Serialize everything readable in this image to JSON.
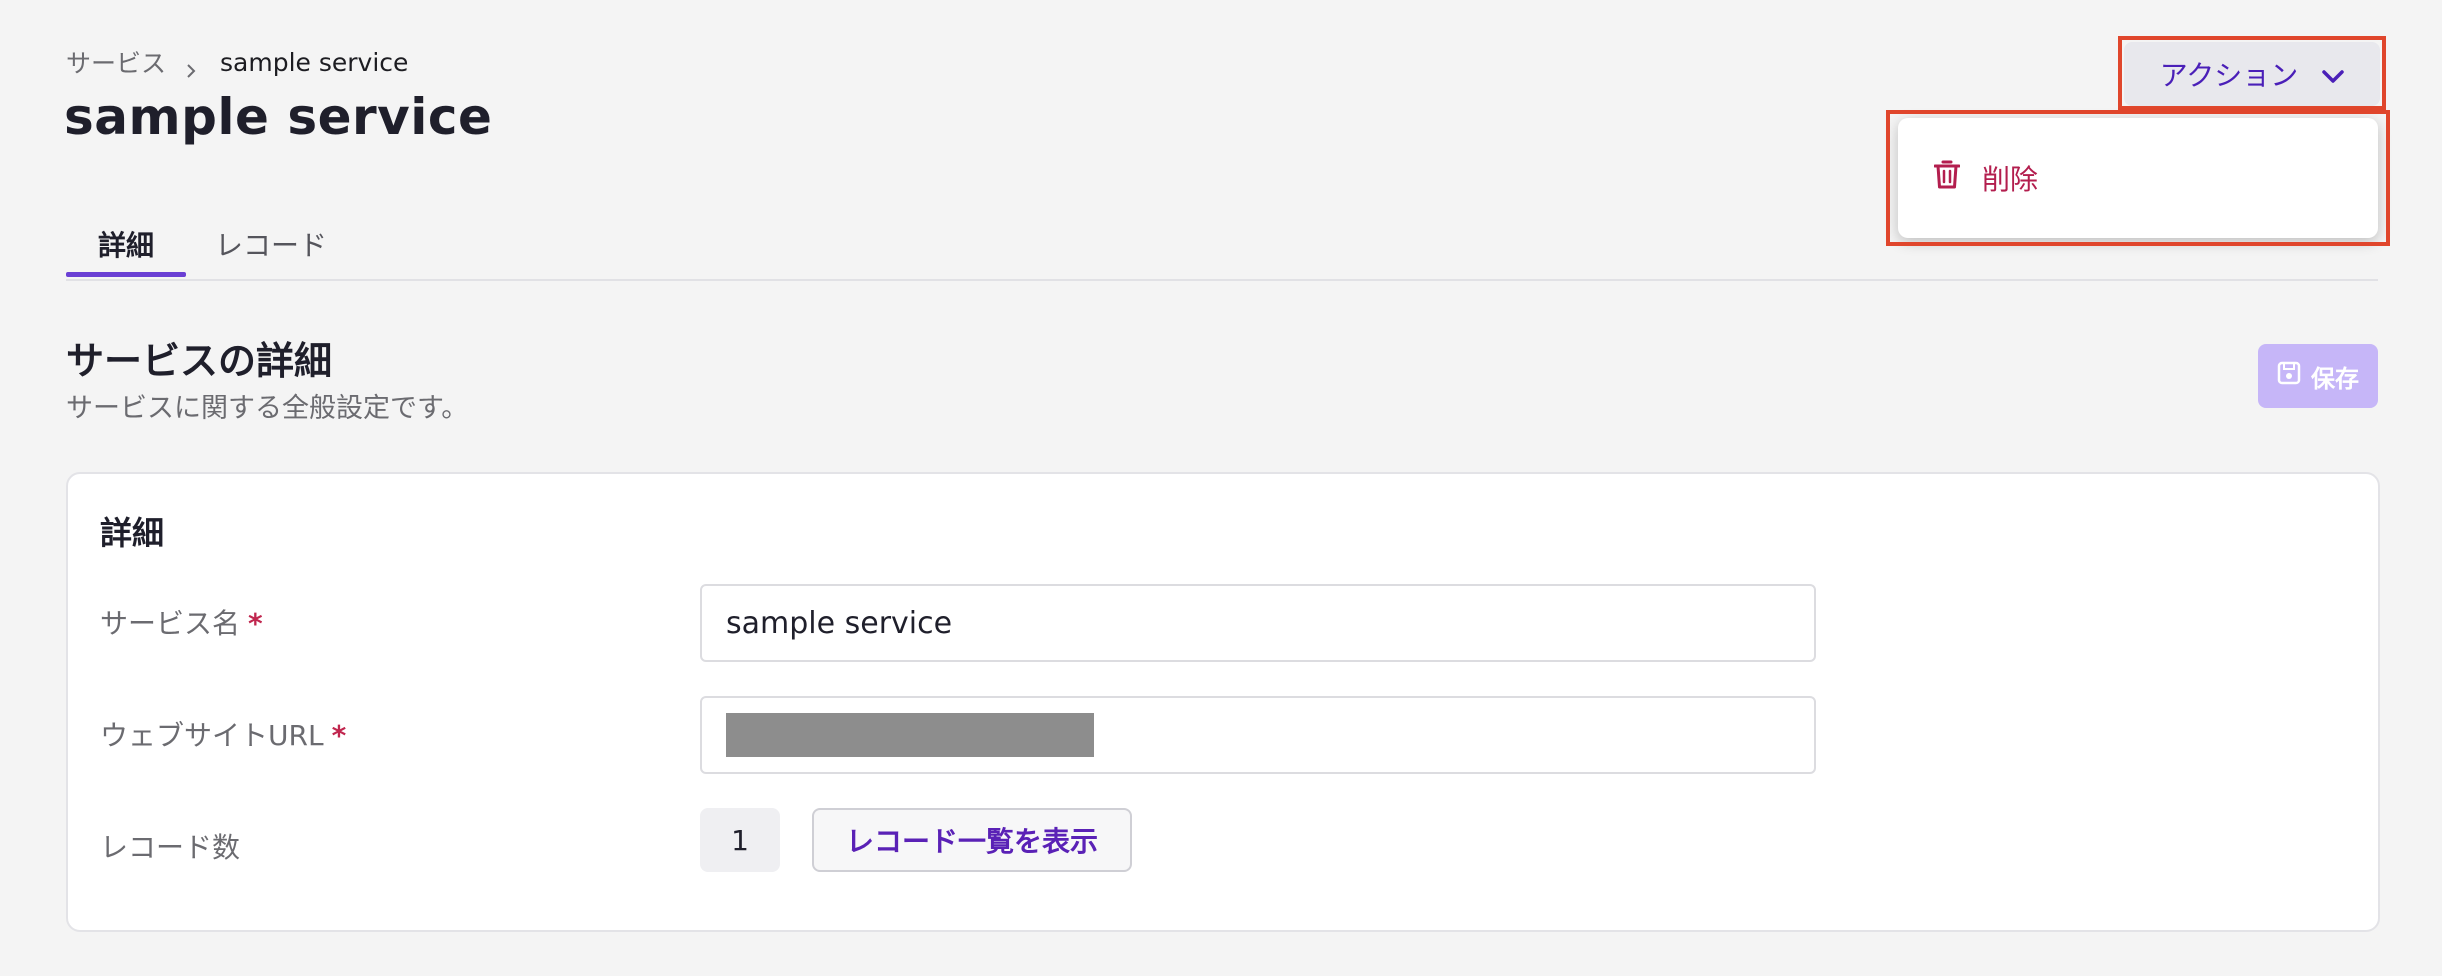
{
  "breadcrumb": {
    "parent": "サービス",
    "current": "sample service"
  },
  "page_title": "sample service",
  "tabs": [
    {
      "label": "詳細",
      "active": true
    },
    {
      "label": "レコード",
      "active": false
    }
  ],
  "section": {
    "title": "サービスの詳細",
    "description": "サービスに関する全般設定です。"
  },
  "save_button": {
    "label": "保存",
    "icon": "save-icon",
    "disabled": true
  },
  "action_menu": {
    "button_label": "アクション",
    "icon": "chevron-down-icon",
    "items": [
      {
        "label": "削除",
        "icon": "trash-icon"
      }
    ]
  },
  "card": {
    "title": "詳細",
    "fields": {
      "service_name": {
        "label": "サービス名",
        "required_mark": "*",
        "value": "sample service"
      },
      "website_url": {
        "label": "ウェブサイトURL",
        "required_mark": "*",
        "value_redacted": true
      },
      "record_count": {
        "label": "レコード数",
        "value": "1",
        "button_label": "レコード一覧を表示"
      }
    }
  },
  "colors": {
    "accent": "#6a3fd4",
    "link_purple": "#5a21b6",
    "danger": "#b31e4e",
    "highlight_box": "#e0462c",
    "save_disabled": "#c6b6f8"
  }
}
